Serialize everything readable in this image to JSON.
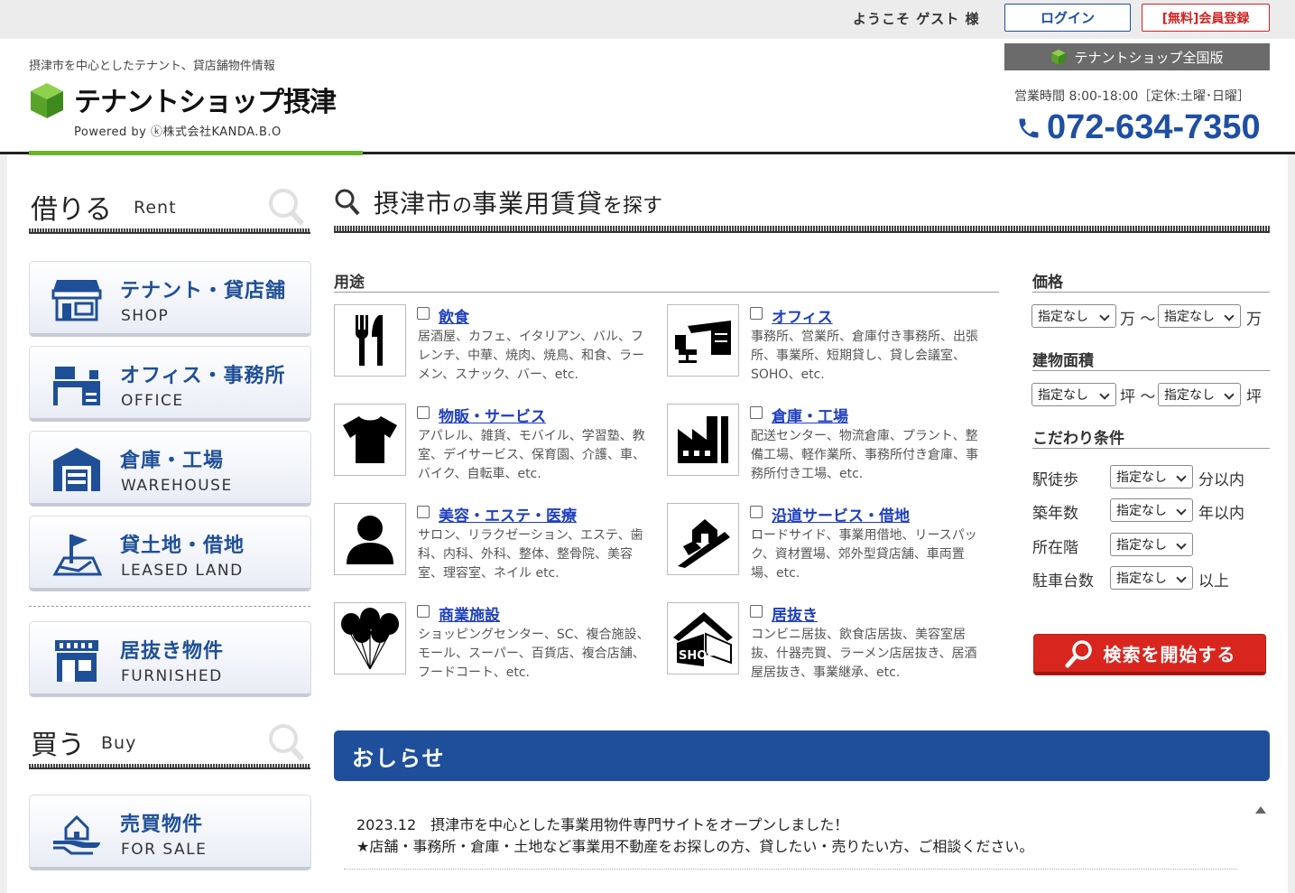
{
  "topbar": {
    "welcome": "ようこそ ゲスト 様",
    "login": "ログイン",
    "register": "[無料]会員登録"
  },
  "header": {
    "tagline": "摂津市を中心としたテナント、貸店舗物件情報",
    "logo_title": "テナントショップ摂津",
    "logo_powered": "Powered by ⓚ株式会社KANDA.B.O",
    "nation_label": "テナントショップ全国版",
    "hours": "営業時間 8:00-18:00［定休:土曜･日曜］",
    "phone": "072-634-7350"
  },
  "sidebar": {
    "rent_jp": "借りる",
    "rent_en": "Rent",
    "rent_items": [
      {
        "jp": "テナント・貸店舗",
        "en": "SHOP"
      },
      {
        "jp": "オフィス・事務所",
        "en": "OFFICE"
      },
      {
        "jp": "倉庫・工場",
        "en": "WAREHOUSE"
      },
      {
        "jp": "貸土地・借地",
        "en": "LEASED LAND"
      },
      {
        "jp": "居抜き物件",
        "en": "FURNISHED"
      }
    ],
    "buy_jp": "買う",
    "buy_en": "Buy",
    "buy_items": [
      {
        "jp": "売買物件",
        "en": "FOR SALE"
      }
    ]
  },
  "search": {
    "title_city": "摂津市",
    "title_no": "の",
    "title_main": "事業用賃貸",
    "title_suffix": "を探す",
    "use_label": "用途",
    "uses": [
      {
        "name": "飲食",
        "desc": "居酒屋、カフェ、イタリアン、バル、フレンチ、中華、焼肉、焼鳥、和食、ラーメン、スナック、バー、etc.",
        "icon": "fork-knife-icon"
      },
      {
        "name": "オフィス",
        "desc": "事務所、営業所、倉庫付き事務所、出張所、事業所、短期貸し、貸し会議室、SOHO、etc.",
        "icon": "office-desk-icon"
      },
      {
        "name": "物販・サービス",
        "desc": "アパレル、雑貨、モバイル、学習塾、教室、デイサービス、保育園、介護、車、バイク、自転車、etc.",
        "icon": "tshirt-icon"
      },
      {
        "name": "倉庫・工場",
        "desc": "配送センター、物流倉庫、プラント、整備工場、軽作業所、事務所付き倉庫、事務所付き工場、etc.",
        "icon": "factory-icon"
      },
      {
        "name": "美容・エステ・医療",
        "desc": "サロン、リラクゼーション、エステ、歯科、内科、外科、整体、整骨院、美容室、理容室、ネイル etc.",
        "icon": "person-icon"
      },
      {
        "name": "沿道サービス・借地",
        "desc": "ロードサイド、事業用借地、リースパック、資材置場、郊外型貸店舗、車両置場、etc.",
        "icon": "roadside-icon"
      },
      {
        "name": "商業施設",
        "desc": "ショッピングセンター、SC、複合施設、モール、スーパー、百貨店、複合店舗、フードコート、etc.",
        "icon": "balloons-icon"
      },
      {
        "name": "居抜き",
        "desc": "コンビニ居抜、飲食店居抜、美容室居抜、什器売買、ラーメン店居抜き、居酒屋居抜き、事業継承、etc.",
        "icon": "shop-house-icon"
      }
    ],
    "price_label": "価格",
    "price_unit1": "万 〜",
    "price_unit2": "万",
    "area_label": "建物面積",
    "area_unit1": "坪 〜",
    "area_unit2": "坪",
    "cond_label": "こだわり条件",
    "default_option": "指定なし",
    "conditions": [
      {
        "label": "駅徒歩",
        "unit": "分以内"
      },
      {
        "label": "築年数",
        "unit": "年以内"
      },
      {
        "label": "所在階",
        "unit": ""
      },
      {
        "label": "駐車台数",
        "unit": "以上"
      }
    ],
    "search_button": "検索を開始する"
  },
  "news": {
    "title": "おしらせ",
    "line1": "2023.12　摂津市を中心とした事業用物件専門サイトをオープンしました！",
    "line2": "★店舗・事務所・倉庫・土地など事業用不動産をお探しの方、貸したい・売りたい方、ご相談ください。"
  },
  "colors": {
    "brand_blue": "#1f4f9b",
    "accent_red": "#d8261f",
    "green": "#6bb52e"
  }
}
